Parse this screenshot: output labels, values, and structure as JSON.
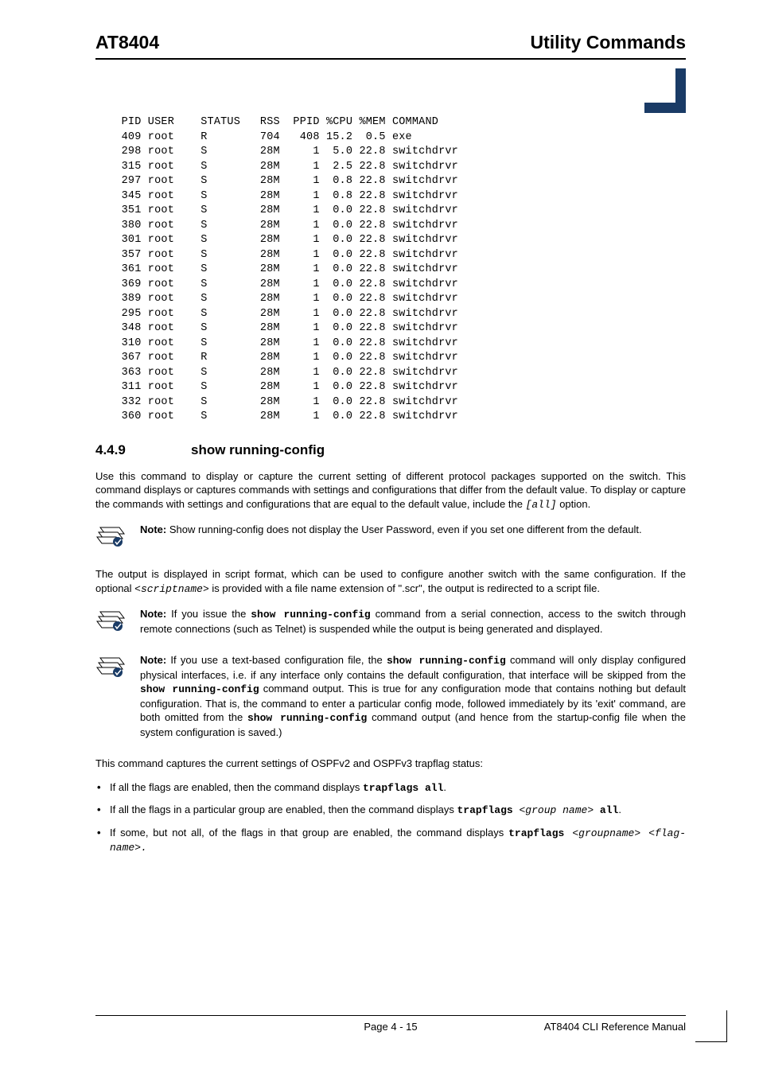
{
  "header": {
    "left": "AT8404",
    "right": "Utility Commands"
  },
  "chart_data": {
    "type": "table",
    "columns": [
      "PID",
      "USER",
      "STATUS",
      "RSS",
      "PPID",
      "%CPU",
      "%MEM",
      "COMMAND"
    ],
    "rows": [
      [
        "409",
        "root",
        "R",
        "704",
        "408",
        "15.2",
        "0.5",
        "exe"
      ],
      [
        "298",
        "root",
        "S",
        "28M",
        "1",
        "5.0",
        "22.8",
        "switchdrvr"
      ],
      [
        "315",
        "root",
        "S",
        "28M",
        "1",
        "2.5",
        "22.8",
        "switchdrvr"
      ],
      [
        "297",
        "root",
        "S",
        "28M",
        "1",
        "0.8",
        "22.8",
        "switchdrvr"
      ],
      [
        "345",
        "root",
        "S",
        "28M",
        "1",
        "0.8",
        "22.8",
        "switchdrvr"
      ],
      [
        "351",
        "root",
        "S",
        "28M",
        "1",
        "0.0",
        "22.8",
        "switchdrvr"
      ],
      [
        "380",
        "root",
        "S",
        "28M",
        "1",
        "0.0",
        "22.8",
        "switchdrvr"
      ],
      [
        "301",
        "root",
        "S",
        "28M",
        "1",
        "0.0",
        "22.8",
        "switchdrvr"
      ],
      [
        "357",
        "root",
        "S",
        "28M",
        "1",
        "0.0",
        "22.8",
        "switchdrvr"
      ],
      [
        "361",
        "root",
        "S",
        "28M",
        "1",
        "0.0",
        "22.8",
        "switchdrvr"
      ],
      [
        "369",
        "root",
        "S",
        "28M",
        "1",
        "0.0",
        "22.8",
        "switchdrvr"
      ],
      [
        "389",
        "root",
        "S",
        "28M",
        "1",
        "0.0",
        "22.8",
        "switchdrvr"
      ],
      [
        "295",
        "root",
        "S",
        "28M",
        "1",
        "0.0",
        "22.8",
        "switchdrvr"
      ],
      [
        "348",
        "root",
        "S",
        "28M",
        "1",
        "0.0",
        "22.8",
        "switchdrvr"
      ],
      [
        "310",
        "root",
        "S",
        "28M",
        "1",
        "0.0",
        "22.8",
        "switchdrvr"
      ],
      [
        "367",
        "root",
        "R",
        "28M",
        "1",
        "0.0",
        "22.8",
        "switchdrvr"
      ],
      [
        "363",
        "root",
        "S",
        "28M",
        "1",
        "0.0",
        "22.8",
        "switchdrvr"
      ],
      [
        "311",
        "root",
        "S",
        "28M",
        "1",
        "0.0",
        "22.8",
        "switchdrvr"
      ],
      [
        "332",
        "root",
        "S",
        "28M",
        "1",
        "0.0",
        "22.8",
        "switchdrvr"
      ],
      [
        "360",
        "root",
        "S",
        "28M",
        "1",
        "0.0",
        "22.8",
        "switchdrvr"
      ]
    ]
  },
  "section": {
    "number": "4.4.9",
    "title": "show running-config"
  },
  "paragraphs": {
    "intro1a": "Use this command to display or capture the current setting of different protocol packages supported on the switch. This command displays or captures commands with settings and configurations that differ from the default value. To display or capture the commands with settings and configurations that are equal to the default value, include the ",
    "intro1_code": "[all]",
    "intro1b": " option.",
    "after_note1": "The output is displayed in script format, which can be used to configure another switch with the same configuration. If the optional ",
    "scriptname": "<scriptname>",
    "after_note1b": " is provided with a file name extension of \".scr\", the output is redirected to a script file.",
    "trap_intro": "This command captures the current settings of OSPFv2 and OSPFv3 trapflag status:"
  },
  "notes": {
    "n1_bold": "Note:",
    "n1": " Show running-config does not display the User Password, even if you set one different from the default.",
    "n2_bold": "Note:",
    "n2a": " If you issue the ",
    "n2_cmd": "show running-config",
    "n2b": " command from a serial connection, access to the switch through remote connections (such as Telnet) is suspended while the output is being generated and displayed.",
    "n3_bold": "Note:",
    "n3a": " If you use a text-based configuration file, the ",
    "n3_cmd1": "show running-config",
    "n3b": " command will only display configured physical interfaces, i.e. if any interface only contains the default configuration, that interface will be skipped from the ",
    "n3_cmd2": "show running-config",
    "n3c": " command output. This is true for any configuration mode that contains nothing but default configuration. That is, the command to enter a particular config mode, followed immediately by its 'exit' command, are both omitted from the ",
    "n3_cmd3": "show running-config",
    "n3d": " command output (and hence from the startup-config file when the system configuration is saved.)"
  },
  "bullets": {
    "b1a": "If all the flags are enabled, then the command displays ",
    "b1_cmd": "trapflags all",
    "b1b": ".",
    "b2a": "If all the flags in a particular group are enabled, then the command displays ",
    "b2_cmd": "trapflags ",
    "b2_arg": "<group name>",
    "b2_all": " all",
    "b2b": ".",
    "b3a": "If some, but not all, of the flags in that group are enabled, the command displays ",
    "b3_cmd": "trapflags ",
    "b3_arg": "<groupname> <flag-name>.",
    "b3b": ""
  },
  "footer": {
    "center": "Page 4 - 15",
    "right": "AT8404 CLI Reference Manual"
  }
}
